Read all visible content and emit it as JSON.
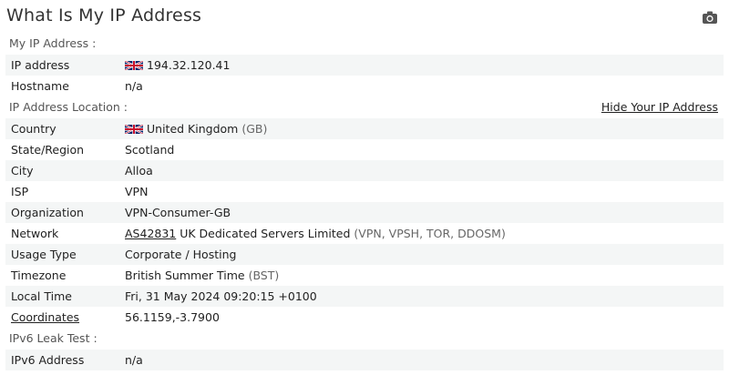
{
  "page": {
    "title": "What Is My IP Address",
    "camera_icon": "camera-icon"
  },
  "my_ip": {
    "section_label": "My IP Address :",
    "rows": [
      {
        "key": "IP address",
        "value": "194.32.120.41",
        "flag": "uk-flag-icon"
      },
      {
        "key": "Hostname",
        "value": "n/a"
      }
    ]
  },
  "location": {
    "section_label": "IP Address Location :",
    "hide_link": "Hide Your IP Address",
    "country": {
      "key": "Country",
      "value": "United Kingdom",
      "extra": "(GB)",
      "flag": "uk-flag-icon"
    },
    "state": {
      "key": "State/Region",
      "value": "Scotland"
    },
    "city": {
      "key": "City",
      "value": "Alloa"
    },
    "isp": {
      "key": "ISP",
      "value": "VPN"
    },
    "organization": {
      "key": "Organization",
      "value": "VPN-Consumer-GB"
    },
    "network": {
      "key": "Network",
      "asn": "AS42831",
      "value": "UK Dedicated Servers Limited",
      "extra": "(VPN, VPSH, TOR, DDOSM)"
    },
    "usage_type": {
      "key": "Usage Type",
      "value": "Corporate / Hosting"
    },
    "timezone": {
      "key": "Timezone",
      "value": "British Summer Time",
      "extra": "(BST)"
    },
    "local_time": {
      "key": "Local Time",
      "value": "Fri, 31 May 2024 09:20:15 +0100"
    },
    "coordinates": {
      "key": "Coordinates",
      "value": "56.1159,-3.7900"
    }
  },
  "ipv6": {
    "section_label": "IPv6 Leak Test :",
    "rows": [
      {
        "key": "IPv6 Address",
        "value": "n/a"
      }
    ]
  },
  "colors": {
    "row_alt_bg": "#f4f6f6",
    "text": "#222222",
    "muted": "#666666"
  }
}
